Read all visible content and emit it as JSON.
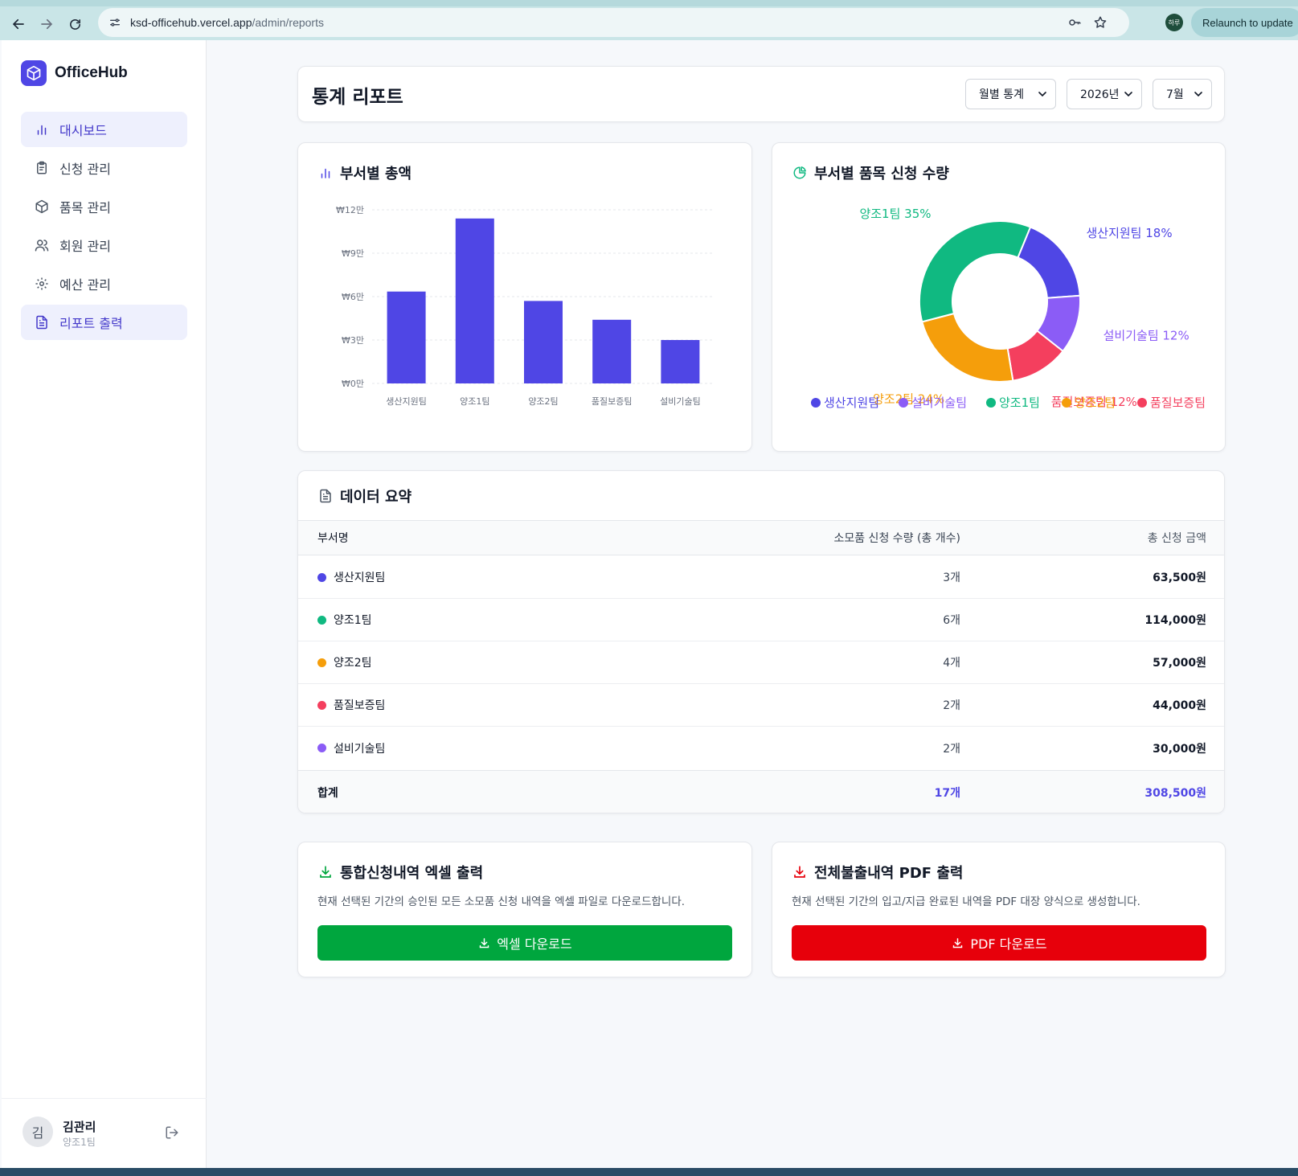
{
  "browser": {
    "url_host": "ksd-officehub.vercel.app",
    "url_path": "/admin/reports",
    "profile_label": "하루",
    "relaunch_label": "Relaunch to update"
  },
  "sidebar": {
    "brand": "OfficeHub",
    "items": [
      {
        "label": "대시보드",
        "icon": "bar-chart-icon",
        "active": true
      },
      {
        "label": "신청 관리",
        "icon": "clipboard-icon",
        "active": false
      },
      {
        "label": "품목 관리",
        "icon": "box-icon",
        "active": false
      },
      {
        "label": "회원 관리",
        "icon": "users-icon",
        "active": false
      },
      {
        "label": "예산 관리",
        "icon": "gear-icon",
        "active": false
      },
      {
        "label": "리포트 출력",
        "icon": "file-icon",
        "active": true
      }
    ],
    "user": {
      "initial": "김",
      "name": "김관리",
      "team": "양조1팀"
    }
  },
  "header": {
    "title": "통계 리포트",
    "period_type": "월별 통계",
    "year": "2026년",
    "month": "7월"
  },
  "bar_card": {
    "title": "부서별 총액"
  },
  "pie_card": {
    "title": "부서별 품목 신청 수량"
  },
  "colors": {
    "primary": "#4f46e5",
    "production": "#4f46e5",
    "brew1": "#10b981",
    "brew2": "#f59e0b",
    "quality": "#f43f5e",
    "facility": "#8b5cf6",
    "excel": "#00a63e",
    "pdf": "#e7000b"
  },
  "chart_data": [
    {
      "type": "bar",
      "categories": [
        "생산지원팀",
        "양조1팀",
        "양조2팀",
        "품질보증팀",
        "설비기술팀"
      ],
      "values": [
        63500,
        114000,
        57000,
        44000,
        30000
      ],
      "ylim": [
        0,
        120000
      ],
      "yticks": [
        0,
        30000,
        60000,
        90000,
        120000
      ],
      "ytick_labels": [
        "₩0만",
        "₩3만",
        "₩6만",
        "₩9만",
        "₩12만"
      ],
      "grid": true
    },
    {
      "type": "pie",
      "donut": true,
      "slices": [
        {
          "name": "생산지원팀",
          "value": 3,
          "label": "생산지원팀 18%",
          "color": "#4f46e5"
        },
        {
          "name": "설비기술팀",
          "value": 2,
          "label": "설비기술팀 12%",
          "color": "#8b5cf6"
        },
        {
          "name": "품질보증팀",
          "value": 2,
          "label": "품질보증팀 12%",
          "color": "#f43f5e"
        },
        {
          "name": "양조2팀",
          "value": 4,
          "label": "양조2팀 24%",
          "color": "#f59e0b"
        },
        {
          "name": "양조1팀",
          "value": 6,
          "label": "양조1팀 35%",
          "color": "#10b981"
        }
      ],
      "legend": [
        {
          "name": "생산지원팀",
          "color": "#4f46e5"
        },
        {
          "name": "설비기술팀",
          "color": "#8b5cf6"
        },
        {
          "name": "양조1팀",
          "color": "#10b981"
        },
        {
          "name": "양조2팀",
          "color": "#f59e0b"
        },
        {
          "name": "품질보증팀",
          "color": "#f43f5e"
        }
      ],
      "legend_position": "bottom"
    }
  ],
  "summary": {
    "title": "데이터 요약",
    "columns": [
      "부서명",
      "소모품 신청 수량 (총 개수)",
      "총 신청 금액"
    ],
    "rows": [
      {
        "name": "생산지원팀",
        "qty": "3개",
        "amount": "63,500원",
        "color": "#4f46e5"
      },
      {
        "name": "양조1팀",
        "qty": "6개",
        "amount": "114,000원",
        "color": "#10b981"
      },
      {
        "name": "양조2팀",
        "qty": "4개",
        "amount": "57,000원",
        "color": "#f59e0b"
      },
      {
        "name": "품질보증팀",
        "qty": "2개",
        "amount": "44,000원",
        "color": "#f43f5e"
      },
      {
        "name": "설비기술팀",
        "qty": "2개",
        "amount": "30,000원",
        "color": "#8b5cf6"
      }
    ],
    "total": {
      "label": "합계",
      "qty": "17개",
      "amount": "308,500원"
    }
  },
  "excel": {
    "title": "통합신청내역 엑셀 출력",
    "description": "현재 선택된 기간의 승인된 모든 소모품 신청 내역을 엑셀 파일로 다운로드합니다.",
    "button": "엑셀 다운로드"
  },
  "pdf": {
    "title": "전체불출내역 PDF 출력",
    "description": "현재 선택된 기간의 입고/지급 완료된 내역을 PDF 대장 양식으로 생성합니다.",
    "button": "PDF 다운로드"
  }
}
